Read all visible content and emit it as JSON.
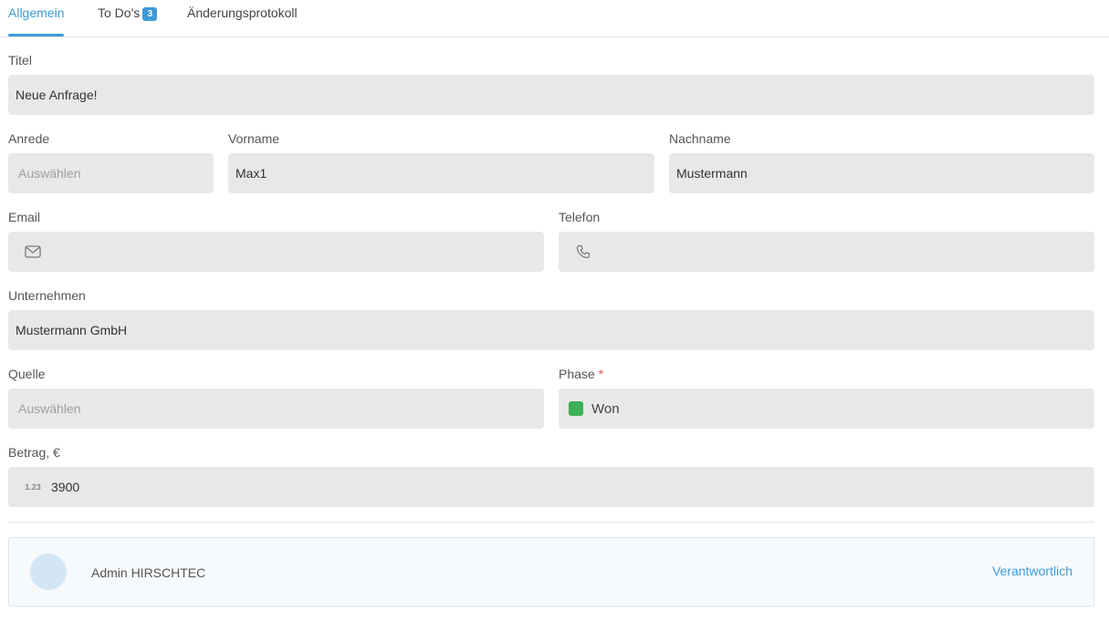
{
  "tabs": [
    {
      "label": "Allgemein",
      "active": true
    },
    {
      "label": "To Do's",
      "badge": "3"
    },
    {
      "label": "Änderungsprotokoll"
    }
  ],
  "form": {
    "titel": {
      "label": "Titel",
      "value": "Neue Anfrage!"
    },
    "anrede": {
      "label": "Anrede",
      "placeholder": "Auswählen"
    },
    "vorname": {
      "label": "Vorname",
      "value": "Max1"
    },
    "nachname": {
      "label": "Nachname",
      "value": "Mustermann"
    },
    "email": {
      "label": "Email",
      "value": "",
      "icon": "envelope-icon"
    },
    "telefon": {
      "label": "Telefon",
      "value": "",
      "icon": "phone-icon"
    },
    "unternehmen": {
      "label": "Unternehmen",
      "value": "Mustermann GmbH"
    },
    "quelle": {
      "label": "Quelle",
      "placeholder": "Auswählen"
    },
    "phase": {
      "label": "Phase",
      "required_mark": "*",
      "value": "Won",
      "color": "#3cb054"
    },
    "betrag": {
      "label": "Betrag, €",
      "icon_text": "1.23",
      "value": "3900"
    }
  },
  "assignee": {
    "name": "Admin HIRSCHTEC",
    "role": "Verantwortlich"
  },
  "colors": {
    "accent": "#3d9bd6",
    "field_bg": "#e8e8e8"
  }
}
